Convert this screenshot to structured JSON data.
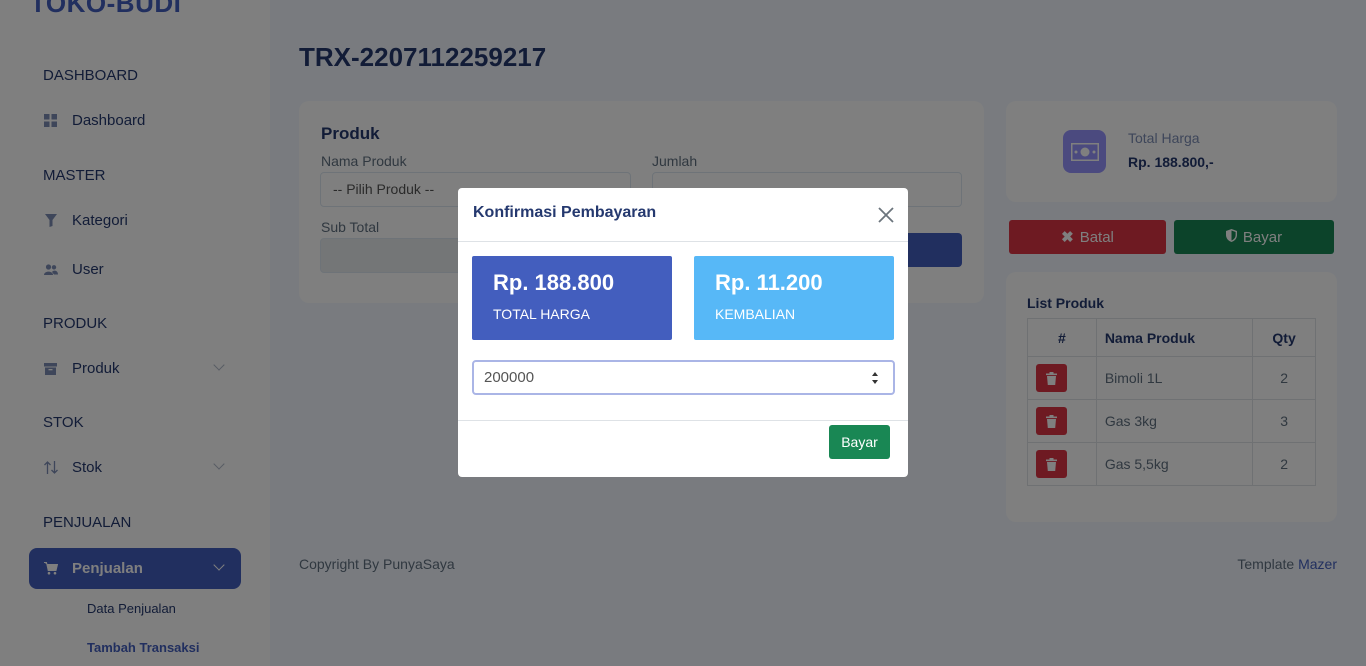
{
  "brand": "TOKO-BUDI",
  "sidebar": {
    "sections": [
      {
        "title": "DASHBOARD"
      },
      {
        "title": "MASTER"
      },
      {
        "title": "PRODUK"
      },
      {
        "title": "STOK"
      },
      {
        "title": "PENJUALAN"
      }
    ],
    "items": {
      "dashboard": "Dashboard",
      "kategori": "Kategori",
      "user": "User",
      "produk": "Produk",
      "stok": "Stok",
      "penjualan": "Penjualan"
    },
    "submenu": [
      "Data Penjualan",
      "Tambah Transaksi"
    ]
  },
  "page": {
    "title": "TRX-2207112259217"
  },
  "product_form": {
    "title": "Produk",
    "nama_produk_label": "Nama Produk",
    "select_value": "-- Pilih Produk --",
    "jumlah_label": "Jumlah",
    "subtotal_label": "Sub Total"
  },
  "summary": {
    "label": "Total Harga",
    "value": "Rp. 188.800,-"
  },
  "actions": {
    "batal": "Batal",
    "bayar": "Bayar"
  },
  "list": {
    "title": "List Produk",
    "headers": [
      "#",
      "Nama Produk",
      "Qty"
    ],
    "rows": [
      {
        "name": "Bimoli 1L",
        "qty": "2"
      },
      {
        "name": "Gas 3kg",
        "qty": "3"
      },
      {
        "name": "Gas 5,5kg",
        "qty": "2"
      }
    ]
  },
  "footer": {
    "left": "Copyright By PunyaSaya",
    "right_prefix": "Template ",
    "right_link": "Mazer"
  },
  "modal": {
    "title": "Konfirmasi Pembayaran",
    "total_value": "Rp. 188.800",
    "total_label": "TOTAL HARGA",
    "change_value": "Rp. 11.200",
    "change_label": "KEMBALIAN",
    "payment_input": "200000",
    "pay_button": "Bayar"
  },
  "colors": {
    "primary": "#435ebe",
    "info": "#57b8f7",
    "success": "#198754",
    "danger": "#dc3545"
  }
}
